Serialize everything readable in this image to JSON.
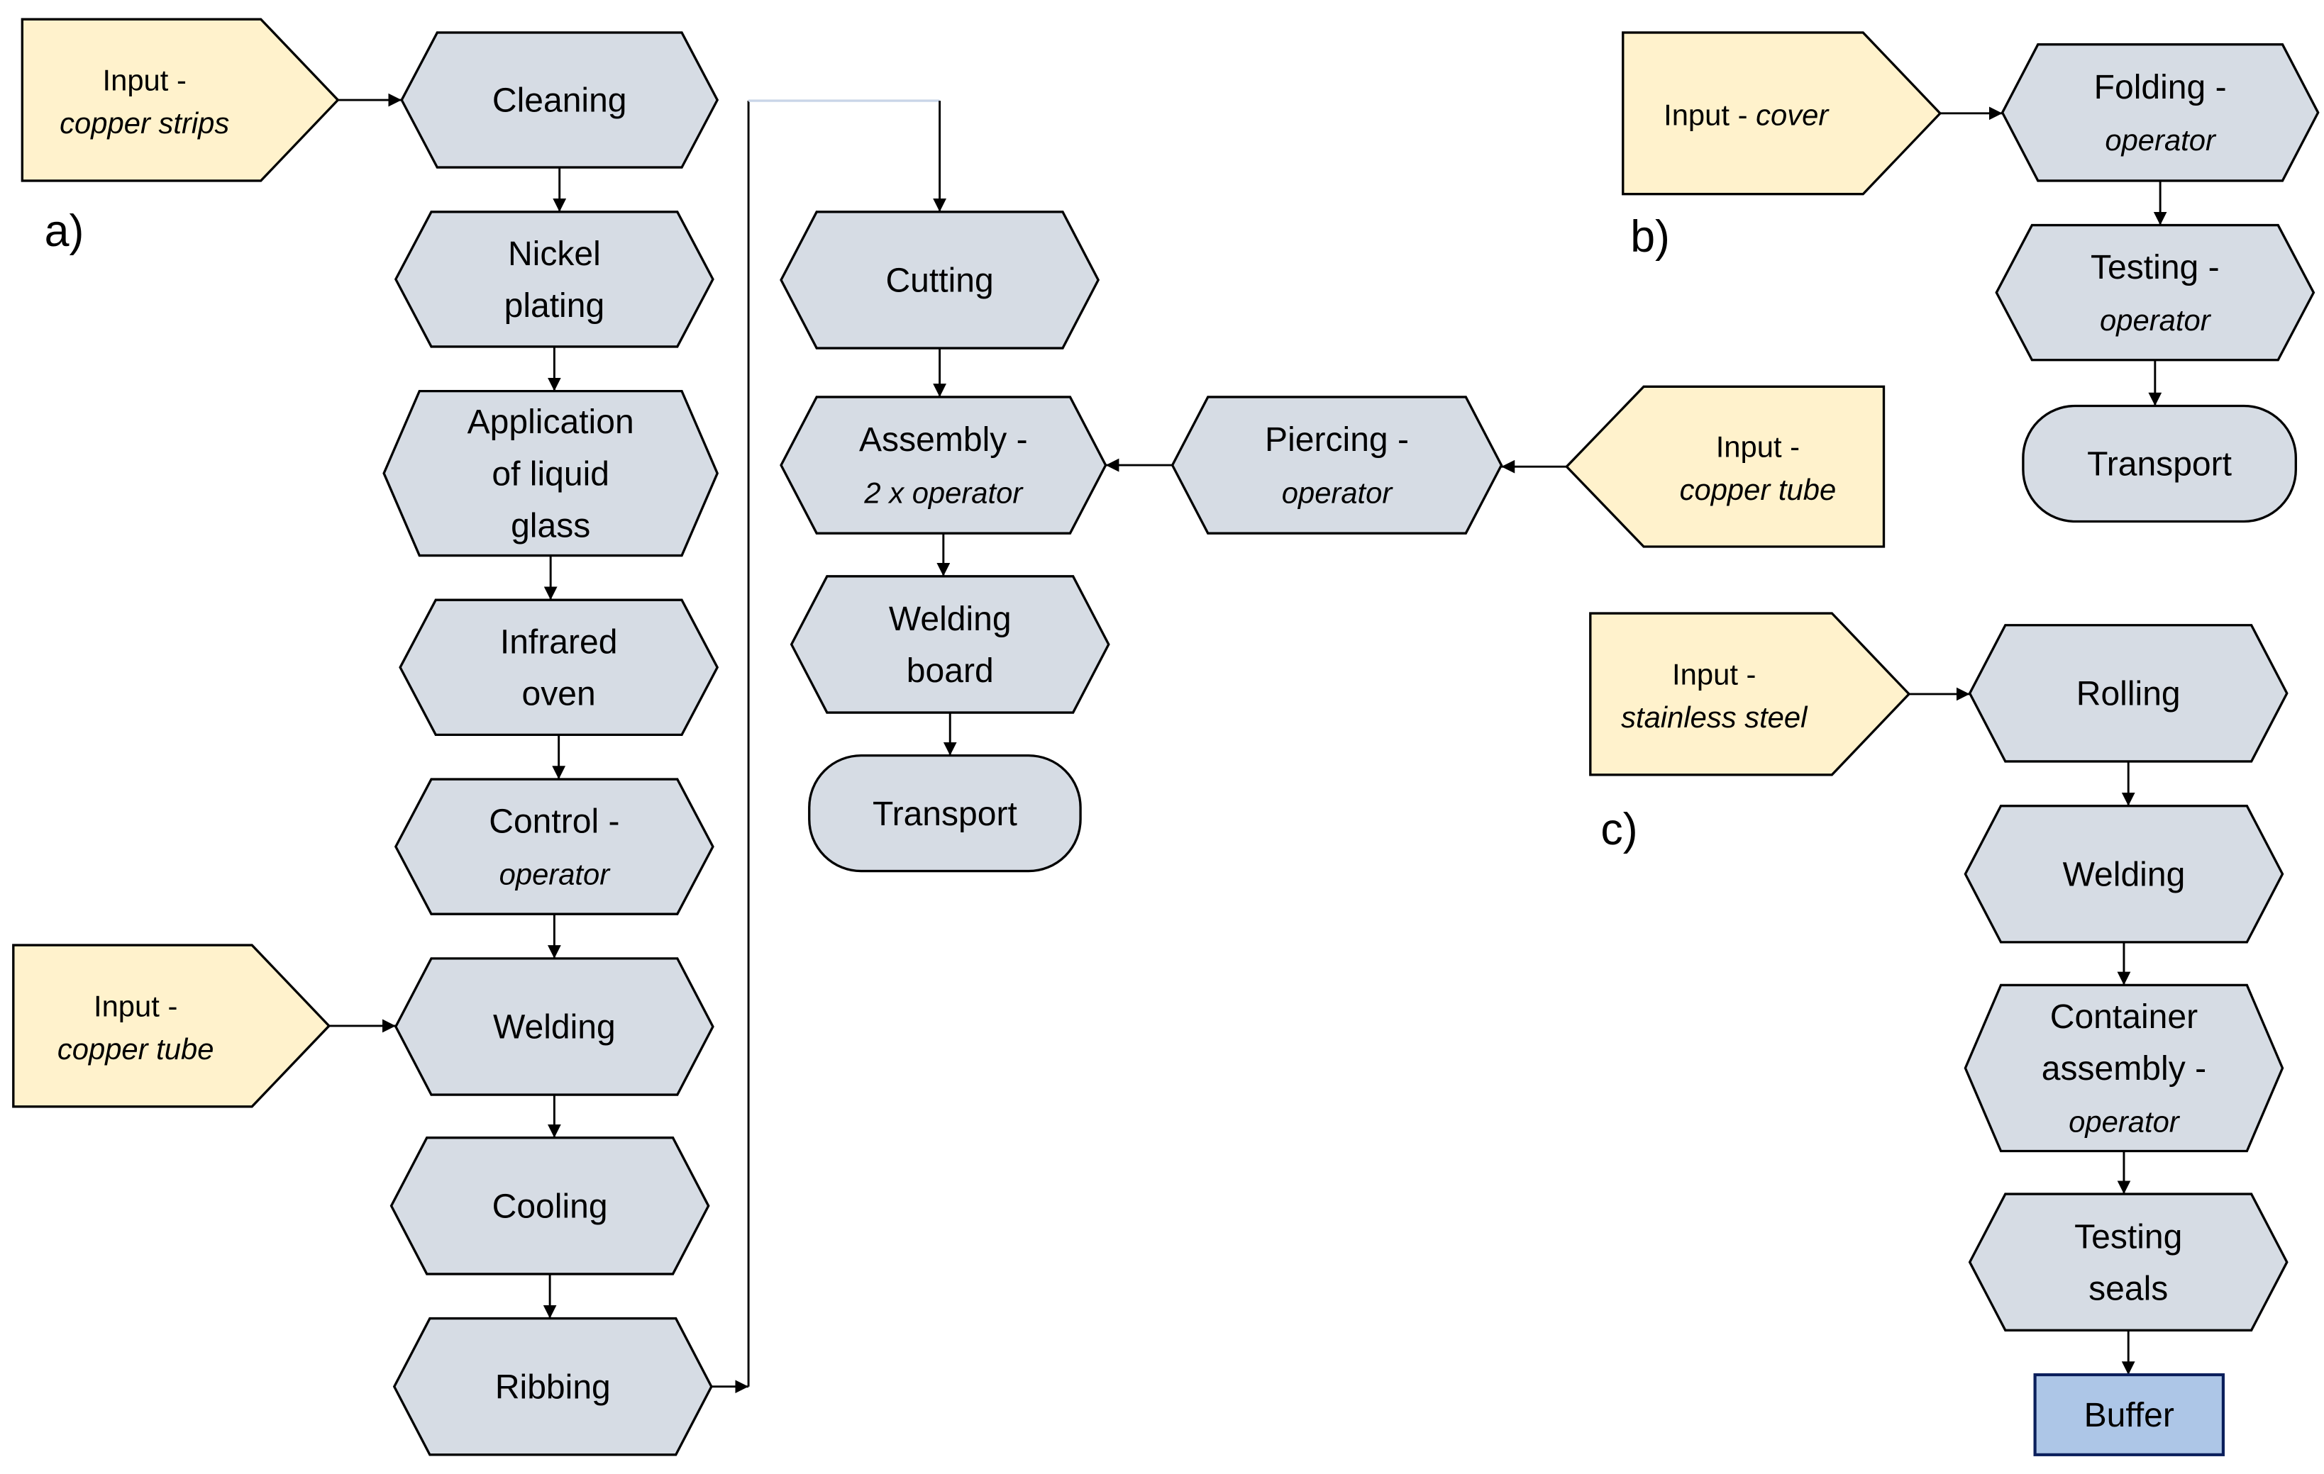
{
  "panels": [
    {
      "id": "a",
      "label": "a)"
    },
    {
      "id": "b",
      "label": "b)"
    },
    {
      "id": "c",
      "label": "c)"
    }
  ],
  "colors": {
    "process_fill": "#d6dce4",
    "input_fill": "#fff2cc",
    "buffer_fill": "#adc6e7",
    "buffer_border": "#0b1f5c",
    "outline": "#000000",
    "connector_light": "#c9d5e8"
  },
  "nodes": {
    "a_input_strips": {
      "type": "input",
      "lines": [
        "Input -"
      ],
      "italic": [
        "copper strips"
      ]
    },
    "a_cleaning": {
      "type": "process",
      "lines": [
        "Cleaning"
      ]
    },
    "a_nickel": {
      "type": "process",
      "lines": [
        "Nickel",
        "plating"
      ]
    },
    "a_liquid_glass": {
      "type": "process",
      "lines": [
        "Application",
        "of liquid",
        "glass"
      ]
    },
    "a_infrared": {
      "type": "process",
      "lines": [
        "Infrared",
        "oven"
      ]
    },
    "a_control": {
      "type": "process",
      "lines": [
        "Control  -"
      ],
      "italic": [
        "operator"
      ]
    },
    "a_input_tube": {
      "type": "input",
      "lines": [
        "Input -"
      ],
      "italic": [
        "copper tube"
      ]
    },
    "a_welding": {
      "type": "process",
      "lines": [
        "Welding"
      ]
    },
    "a_cooling": {
      "type": "process",
      "lines": [
        "Cooling"
      ]
    },
    "a_ribbing": {
      "type": "process",
      "lines": [
        "Ribbing"
      ]
    },
    "a_cutting": {
      "type": "process",
      "lines": [
        "Cutting"
      ]
    },
    "a_assembly": {
      "type": "process",
      "lines": [
        "Assembly  -"
      ],
      "italic": [
        "2 x operator"
      ]
    },
    "a_piercing": {
      "type": "process",
      "lines": [
        "Piercing  -"
      ],
      "italic": [
        "operator"
      ]
    },
    "a_input_tube2": {
      "type": "input",
      "lines": [
        "Input -"
      ],
      "italic": [
        "copper tube"
      ]
    },
    "a_welding_board": {
      "type": "process",
      "lines": [
        "Welding",
        "board"
      ]
    },
    "a_transport": {
      "type": "terminal",
      "lines": [
        "Transport"
      ]
    },
    "b_input_cover": {
      "type": "input",
      "lines": [
        "Input - "
      ],
      "italic_inline": "cover"
    },
    "b_folding": {
      "type": "process",
      "lines": [
        "Folding  -"
      ],
      "italic": [
        "operator"
      ]
    },
    "b_testing": {
      "type": "process",
      "lines": [
        "Testing  -"
      ],
      "italic": [
        "operator"
      ]
    },
    "b_transport": {
      "type": "terminal",
      "lines": [
        "Transport"
      ]
    },
    "c_input_steel": {
      "type": "input",
      "lines": [
        "Input -"
      ],
      "italic": [
        "stainless steel"
      ]
    },
    "c_rolling": {
      "type": "process",
      "lines": [
        "Rolling"
      ]
    },
    "c_welding": {
      "type": "process",
      "lines": [
        "Welding"
      ]
    },
    "c_container": {
      "type": "process",
      "lines": [
        "Container",
        "assembly -"
      ],
      "italic": [
        "operator"
      ]
    },
    "c_testing_seals": {
      "type": "process",
      "lines": [
        "Testing",
        "seals"
      ]
    },
    "c_buffer": {
      "type": "buffer",
      "lines": [
        "Buffer"
      ]
    }
  },
  "edges": [
    [
      "a_input_strips",
      "a_cleaning"
    ],
    [
      "a_cleaning",
      "a_nickel"
    ],
    [
      "a_nickel",
      "a_liquid_glass"
    ],
    [
      "a_liquid_glass",
      "a_infrared"
    ],
    [
      "a_infrared",
      "a_control"
    ],
    [
      "a_control",
      "a_welding"
    ],
    [
      "a_input_tube",
      "a_welding"
    ],
    [
      "a_welding",
      "a_cooling"
    ],
    [
      "a_cooling",
      "a_ribbing"
    ],
    [
      "a_ribbing",
      "a_cutting"
    ],
    [
      "a_cutting",
      "a_assembly"
    ],
    [
      "a_input_tube2",
      "a_piercing"
    ],
    [
      "a_piercing",
      "a_assembly"
    ],
    [
      "a_assembly",
      "a_welding_board"
    ],
    [
      "a_welding_board",
      "a_transport"
    ],
    [
      "b_input_cover",
      "b_folding"
    ],
    [
      "b_folding",
      "b_testing"
    ],
    [
      "b_testing",
      "b_transport"
    ],
    [
      "c_input_steel",
      "c_rolling"
    ],
    [
      "c_rolling",
      "c_welding"
    ],
    [
      "c_welding",
      "c_container"
    ],
    [
      "c_container",
      "c_testing_seals"
    ],
    [
      "c_testing_seals",
      "c_buffer"
    ]
  ]
}
